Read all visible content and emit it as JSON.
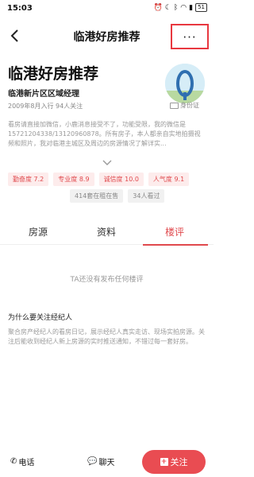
{
  "status_bar": {
    "time": "15:03",
    "icons": [
      "alarm-icon",
      "moon-icon",
      "bluetooth-icon",
      "wifi-icon",
      "signal-icon"
    ],
    "battery": "51"
  },
  "nav": {
    "title": "临港好房推荐",
    "more": "···"
  },
  "profile": {
    "headline": "临港好房推荐",
    "title": "临港新片区区域经理",
    "meta": "2009年8月入行 94人关注",
    "id_badge": "身份证",
    "bio": "看房请直接加微信，小鹿消息接受不了，功能受限，我的微信是15721204338/13120960878。所有房子，本人都亲自实地拍摄视频和照片，我对临港主城区及周边的房源情况了解详实..."
  },
  "scores": [
    {
      "label": "勤奋度",
      "value": "7.2"
    },
    {
      "label": "专业度",
      "value": "8.9"
    },
    {
      "label": "诚信度",
      "value": "10.0"
    },
    {
      "label": "人气度",
      "value": "9.1"
    }
  ],
  "stats": [
    "414套在租在售",
    "34人看过"
  ],
  "tabs": [
    "房源",
    "资料",
    "楼评"
  ],
  "empty_text": "TA还没有发布任何楼评",
  "why": {
    "title": "为什么要关注经纪人",
    "text": "聚合房产经纪人的看房日记，展示经纪人真实走访、现场实拍房源。关注后能收到经纪人新上房源的实时推送通知，不错过每一套好房。"
  },
  "bottom": {
    "call": "电话",
    "chat": "聊天",
    "follow": "关注"
  },
  "colors": {
    "accent": "#e94c52",
    "highlight_border": "#e8383f",
    "score_bg": "#fdecec",
    "stat_bg": "#f1f1f1"
  }
}
